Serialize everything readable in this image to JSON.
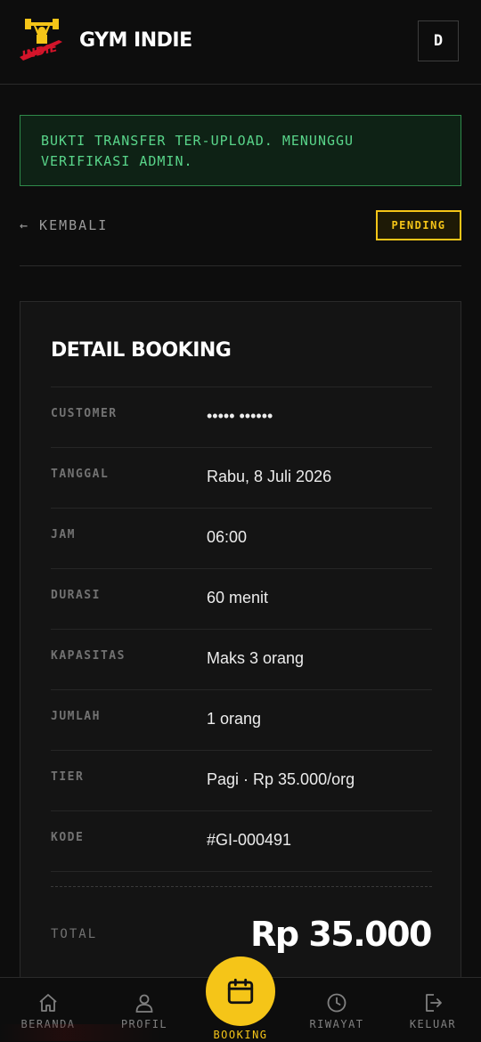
{
  "header": {
    "logo_text": "INDIE",
    "brand": "GYM INDIE",
    "avatar_initial": "D"
  },
  "alert": {
    "line1": "BUKTI TRANSFER TER-UPLOAD. MENUNGGU",
    "line2": "VERIFIKASI ADMIN."
  },
  "back_label": "← KEMBALI",
  "status_badge": "PENDING",
  "detail": {
    "title": "DETAIL BOOKING",
    "rows": [
      {
        "label": "CUSTOMER",
        "value": "••••• ••••••"
      },
      {
        "label": "TANGGAL",
        "value": "Rabu, 8 Juli 2026"
      },
      {
        "label": "JAM",
        "value": "06:00"
      },
      {
        "label": "DURASI",
        "value": "60 menit"
      },
      {
        "label": "KAPASITAS",
        "value": "Maks 3 orang"
      },
      {
        "label": "JUMLAH",
        "value": "1 orang"
      },
      {
        "label": "TIER",
        "value": "Pagi · Rp 35.000/org"
      },
      {
        "label": "KODE",
        "value": "#GI-000491"
      }
    ],
    "total_label": "TOTAL",
    "total_value": "Rp 35.000"
  },
  "nav": {
    "items": [
      {
        "label": "BERANDA",
        "icon": "home-icon"
      },
      {
        "label": "PROFIL",
        "icon": "user-icon"
      },
      {
        "label": "BOOKING",
        "icon": "calendar-icon"
      },
      {
        "label": "RIWAYAT",
        "icon": "clock-icon"
      },
      {
        "label": "KELUAR",
        "icon": "logout-icon"
      }
    ]
  },
  "colors": {
    "accent": "#f5c518",
    "success": "#59d58a",
    "background": "#0d0d0d"
  }
}
